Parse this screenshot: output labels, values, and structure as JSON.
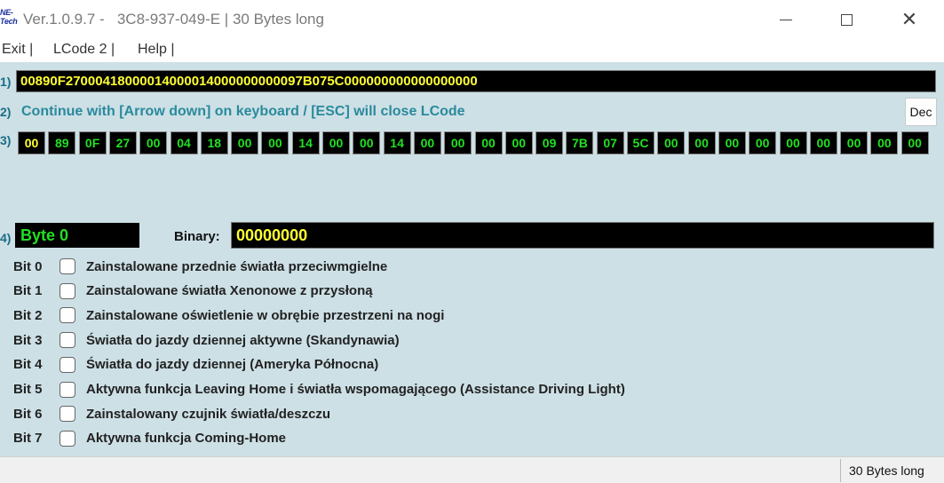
{
  "window": {
    "logo": "NE-Tech",
    "title": "Ver.1.0.9.7 -   3C8-937-049-E | 30 Bytes long"
  },
  "menu": {
    "exit": "Exit |",
    "lcode2": "LCode 2 |",
    "help": "Help |"
  },
  "rows": {
    "r1": "1)",
    "r2": "2)",
    "r3": "3)",
    "r4": "4)"
  },
  "hex_string": "00890F27000418000014000014000000000097B075C000000000000000000",
  "instruction": "Continue with [Arrow down] on keyboard / [ESC] will close LCode",
  "dec_button": "Dec",
  "bytes": [
    "00",
    "89",
    "0F",
    "27",
    "00",
    "04",
    "18",
    "00",
    "00",
    "14",
    "00",
    "00",
    "14",
    "00",
    "00",
    "00",
    "00",
    "09",
    "7B",
    "07",
    "5C",
    "00",
    "00",
    "00",
    "00",
    "00",
    "00",
    "00",
    "00",
    "00"
  ],
  "selected_byte": 0,
  "byte_label": "Byte 0",
  "binary_label": "Binary:",
  "binary_value": "00000000",
  "bits": [
    {
      "label": "Bit 0",
      "desc": "Zainstalowane przednie światła przeciwmgielne",
      "checked": false
    },
    {
      "label": "Bit 1",
      "desc": "Zainstalowane światła Xenonowe z przysłoną",
      "checked": false
    },
    {
      "label": "Bit 2",
      "desc": "Zainstalowane oświetlenie w obrębie przestrzeni na nogi",
      "checked": false
    },
    {
      "label": "Bit 3",
      "desc": "Światła do jazdy dziennej aktywne (Skandynawia)",
      "checked": false
    },
    {
      "label": "Bit 4",
      "desc": "Światła do jazdy dziennej (Ameryka Północna)",
      "checked": false
    },
    {
      "label": "Bit 5",
      "desc": "Aktywna funkcja Leaving Home i światła wspomagającego (Assistance Driving Light)",
      "checked": false
    },
    {
      "label": "Bit 6",
      "desc": "Zainstalowany czujnik światła/deszczu",
      "checked": false
    },
    {
      "label": "Bit 7",
      "desc": "Aktywna funkcja Coming-Home",
      "checked": false
    }
  ],
  "status": "30 Bytes long",
  "colors": {
    "panel_bg": "#cde0e6",
    "field_bg": "#000000",
    "hex_text": "#ffff33",
    "byte_text": "#22e022",
    "instruction_text": "#2a8a9c"
  }
}
